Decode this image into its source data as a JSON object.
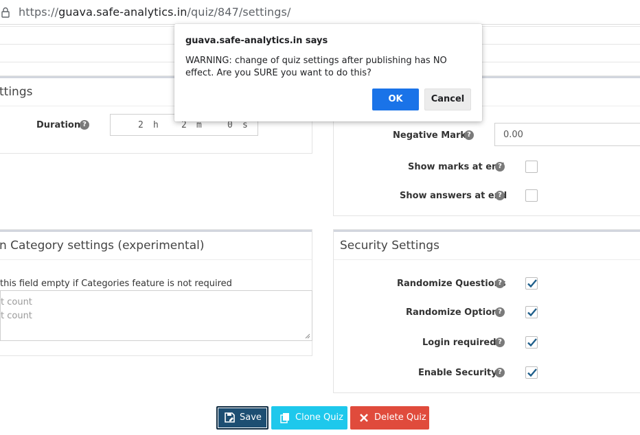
{
  "browser": {
    "url_prefix": "https://",
    "url_host": "guava.safe-analytics.in",
    "url_path": "/quiz/847/settings/"
  },
  "general_panel": {
    "title_visible": "ttings",
    "duration_label": "Duration",
    "duration": {
      "hours": "2",
      "hours_unit": "h",
      "minutes": "2",
      "minutes_unit": "m",
      "seconds": "0",
      "seconds_unit": "s"
    }
  },
  "marks_panel": {
    "negative_marks_label": "Negative Marks",
    "negative_marks_value": "0.00",
    "show_marks_label": "Show marks at end",
    "show_marks_checked": false,
    "show_answers_label": "Show answers at end",
    "show_answers_checked": false
  },
  "category_panel": {
    "title_visible": "n Category settings (experimental)",
    "hint_visible": "this field empty if Categories feature is not required",
    "textarea_lines_visible": [
      "t count",
      "t count"
    ]
  },
  "security_panel": {
    "title": "Security Settings",
    "items": [
      {
        "label": "Randomize Questions",
        "checked": true
      },
      {
        "label": "Randomize Options",
        "checked": true
      },
      {
        "label": "Login required?",
        "checked": true
      },
      {
        "label": "Enable Security?",
        "checked": true
      }
    ]
  },
  "actions": {
    "save_label": "Save",
    "clone_label": "Clone Quiz",
    "delete_label": "Delete Quiz"
  },
  "dialog": {
    "title": "guava.safe-analytics.in says",
    "message": "WARNING: change of quiz settings after publishing has NO effect.  Are you SURE you want to do this?",
    "ok_label": "OK",
    "cancel_label": "Cancel"
  },
  "colors": {
    "ok_button": "#1a73e8",
    "save_button": "#1d4e72",
    "clone_button": "#1ec8ec",
    "delete_button": "#e04b3c",
    "checkbox_tick": "#1f5f8b"
  }
}
